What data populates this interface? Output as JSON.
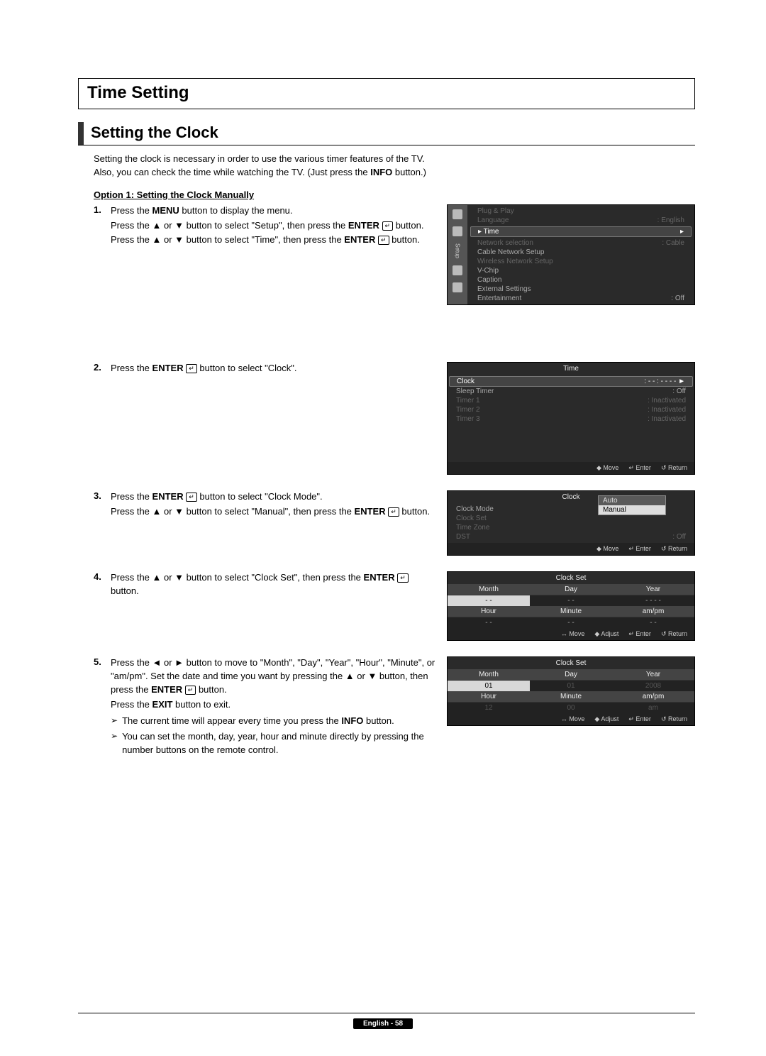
{
  "header": {
    "title": "Time Setting"
  },
  "sub": {
    "title": "Setting the Clock"
  },
  "intro": {
    "l1": "Setting the clock is necessary in order to use the various timer features of the TV.",
    "l2_a": "Also, you can check the time while watching the TV. (Just press the ",
    "l2_b": "INFO",
    "l2_c": " button.)"
  },
  "option_title": "Option 1: Setting the Clock Manually",
  "enter_icon": "↵",
  "steps": {
    "s1": {
      "num": "1.",
      "p1a": "Press the ",
      "p1b": "MENU",
      "p1c": " button to display the menu.",
      "p2a": "Press the ▲ or ▼ button to select \"Setup\", then press the ",
      "p2b": "ENTER",
      "p2c": " button.",
      "p3a": "Press the ▲ or ▼ button to select \"Time\", then press the ",
      "p3b": "ENTER",
      "p3c": " button."
    },
    "s2": {
      "num": "2.",
      "p1a": "Press the ",
      "p1b": "ENTER",
      "p1c": " button to select \"Clock\"."
    },
    "s3": {
      "num": "3.",
      "p1a": "Press the ",
      "p1b": "ENTER",
      "p1c": " button to select \"Clock Mode\".",
      "p2a": "Press the ▲ or ▼ button to select \"Manual\", then press the ",
      "p2b": "ENTER",
      "p2c": " button."
    },
    "s4": {
      "num": "4.",
      "p1a": "Press the ▲ or ▼ button to select \"Clock Set\", then press the ",
      "p1b": "ENTER",
      "p1c": " button."
    },
    "s5": {
      "num": "5.",
      "p1": "Press the ◄ or ► button to move to \"Month\", \"Day\", \"Year\", \"Hour\", \"Minute\", or \"am/pm\". Set the date and time you want by pressing the ▲ or ▼ button, then press the ",
      "p1b": "ENTER",
      "p1c": " button.",
      "p2a": "Press the ",
      "p2b": "EXIT",
      "p2c": " button to exit.",
      "n1a": "The current time will appear every time you press the ",
      "n1b": "INFO",
      "n1c": " button.",
      "n2": "You can set the month, day, year, hour and minute directly by pressing the number buttons on the remote control."
    }
  },
  "note_icon": "➢",
  "tv_setup": {
    "side_label": "Setup",
    "rows": [
      {
        "l": "Plug & Play",
        "r": ""
      },
      {
        "l": "Language",
        "r": ": English"
      }
    ],
    "hi": {
      "l": "▸ Time",
      "r": "▸"
    },
    "rows2": [
      {
        "l": "Network selection",
        "r": ": Cable"
      },
      {
        "l": "Cable Network Setup",
        "r": ""
      },
      {
        "l": "Wireless Network Setup",
        "r": ""
      },
      {
        "l": "V-Chip",
        "r": ""
      },
      {
        "l": "Caption",
        "r": ""
      },
      {
        "l": "External Settings",
        "r": ""
      },
      {
        "l": "Entertainment",
        "r": ": Off"
      }
    ]
  },
  "tv_time": {
    "title": "Time",
    "hi": {
      "l": "Clock",
      "r": ": - - : - -  - -           ►"
    },
    "rows": [
      {
        "l": "Sleep Timer",
        "r": ": Off"
      },
      {
        "l": "Timer 1",
        "r": ": Inactivated",
        "dim": true
      },
      {
        "l": "Timer 2",
        "r": ": Inactivated",
        "dim": true
      },
      {
        "l": "Timer 3",
        "r": ": Inactivated",
        "dim": true
      }
    ],
    "foot": [
      "◆ Move",
      "↵ Enter",
      "↺ Return"
    ]
  },
  "tv_clock": {
    "title": "Clock",
    "rows": [
      {
        "l": "Clock Mode",
        "r": ""
      },
      {
        "l": "Clock Set",
        "r": "",
        "dim": true
      },
      {
        "l": "Time Zone",
        "r": "",
        "dim": true
      },
      {
        "l": "DST",
        "r": ": Off",
        "dim": true
      }
    ],
    "popup": {
      "opt1": "Auto",
      "opt2": "Manual"
    },
    "foot": [
      "◆ Move",
      "↵ Enter",
      "↺ Return"
    ]
  },
  "tv_cs1": {
    "title": "Clock Set",
    "heads1": [
      "Month",
      "Day",
      "Year"
    ],
    "vals1": [
      "- -",
      "- -",
      "- - - -"
    ],
    "heads2": [
      "Hour",
      "Minute",
      "am/pm"
    ],
    "vals2": [
      "- -",
      "- -",
      "- -"
    ],
    "foot": [
      "↔ Move",
      "◆ Adjust",
      "↵ Enter",
      "↺ Return"
    ]
  },
  "tv_cs2": {
    "title": "Clock Set",
    "heads1": [
      "Month",
      "Day",
      "Year"
    ],
    "vals1": [
      "01",
      "01",
      "2008"
    ],
    "heads2": [
      "Hour",
      "Minute",
      "am/pm"
    ],
    "vals2": [
      "12",
      "00",
      "am"
    ],
    "foot": [
      "↔ Move",
      "◆ Adjust",
      "↵ Enter",
      "↺ Return"
    ]
  },
  "footer": {
    "text": "English - 58"
  }
}
